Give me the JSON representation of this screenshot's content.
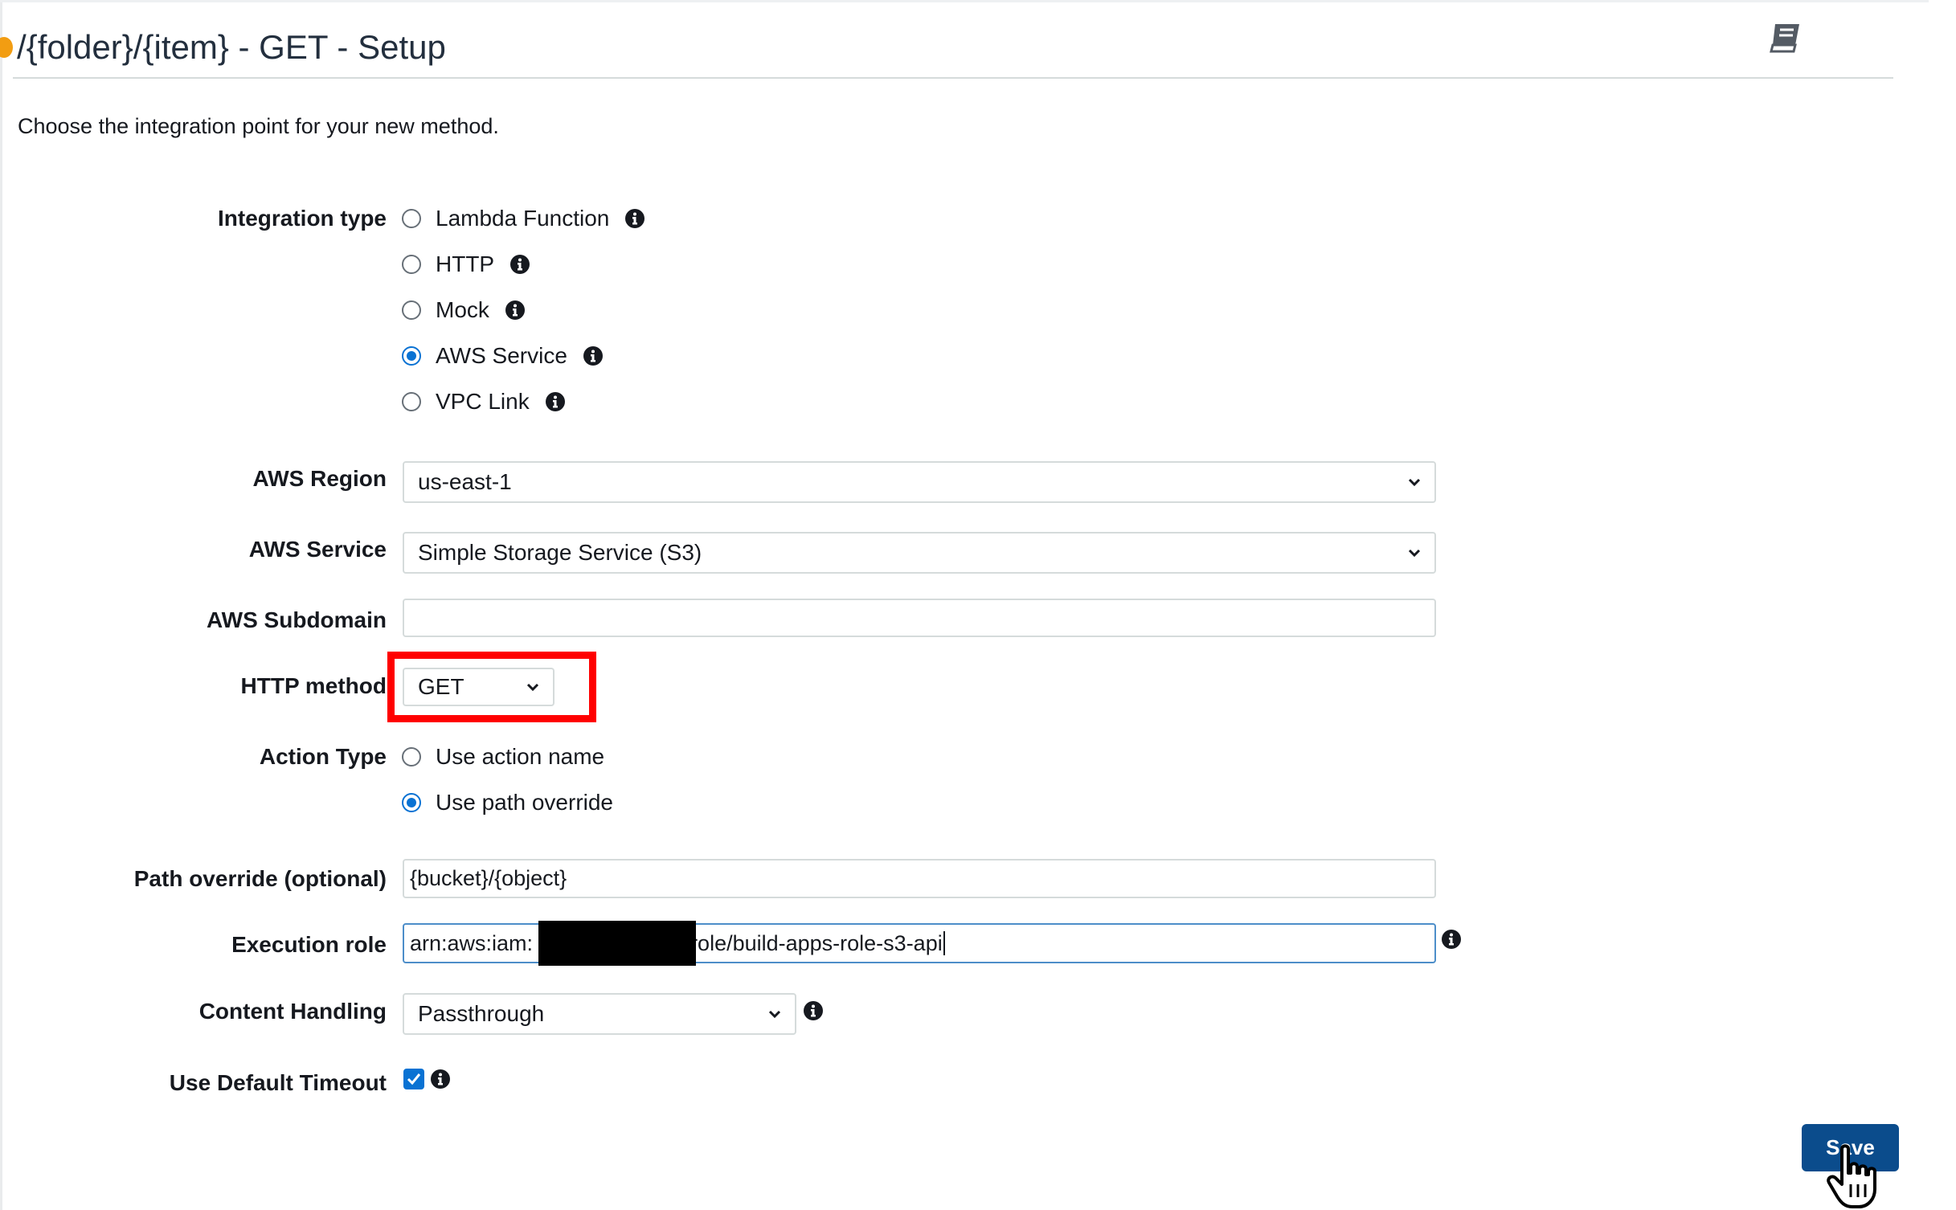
{
  "page": {
    "title": "/{folder}/{item} - GET - Setup",
    "intro": "Choose the integration point for your new method."
  },
  "integration_type": {
    "label": "Integration type",
    "options": [
      {
        "label": "Lambda Function",
        "selected": false
      },
      {
        "label": "HTTP",
        "selected": false
      },
      {
        "label": "Mock",
        "selected": false
      },
      {
        "label": "AWS Service",
        "selected": true
      },
      {
        "label": "VPC Link",
        "selected": false
      }
    ]
  },
  "aws_region": {
    "label": "AWS Region",
    "value": "us-east-1"
  },
  "aws_service": {
    "label": "AWS Service",
    "value": "Simple Storage Service (S3)"
  },
  "aws_subdomain": {
    "label": "AWS Subdomain",
    "value": ""
  },
  "http_method": {
    "label": "HTTP method",
    "value": "GET"
  },
  "action_type": {
    "label": "Action Type",
    "options": [
      {
        "label": "Use action name",
        "selected": false
      },
      {
        "label": "Use path override",
        "selected": true
      }
    ]
  },
  "path_override": {
    "label": "Path override (optional)",
    "value": "{bucket}/{object}"
  },
  "execution_role": {
    "label": "Execution role",
    "prefix": "arn:aws:iam:",
    "suffix": "role/build-apps-role-s3-api"
  },
  "content_handling": {
    "label": "Content Handling",
    "value": "Passthrough"
  },
  "default_timeout": {
    "label": "Use Default Timeout",
    "checked": true
  },
  "save_label": "Save",
  "colors": {
    "accent": "#0972d3",
    "save_button": "#0b4c8c",
    "highlight": "#ff0000",
    "orange": "#f29d12"
  }
}
